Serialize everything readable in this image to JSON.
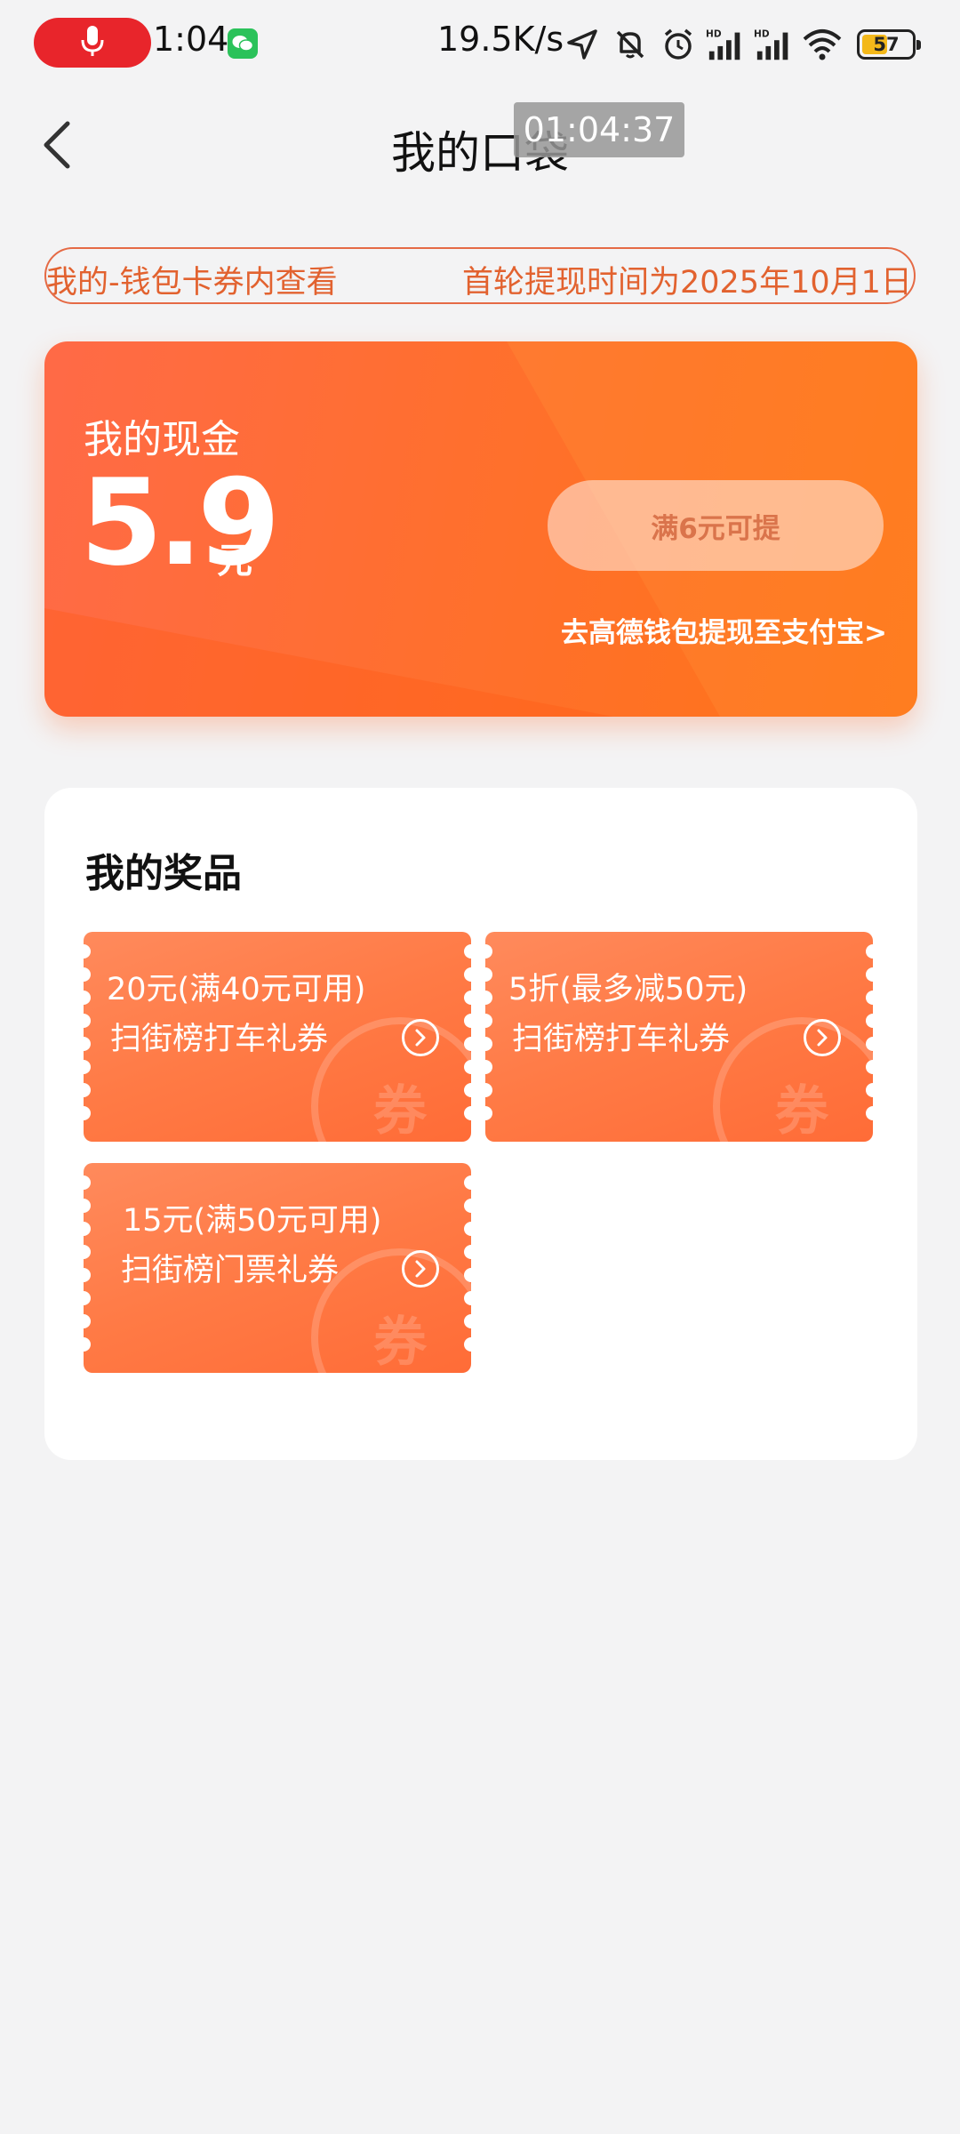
{
  "status_bar": {
    "time": "1:04",
    "network_speed": "19.5K/s",
    "battery_level": "57",
    "icons": [
      "microphone-icon",
      "wechat-icon",
      "location-icon",
      "mute-bell-icon",
      "alarm-icon",
      "hd-signal-icon",
      "hd-signal-icon",
      "wifi-icon",
      "battery-icon"
    ]
  },
  "nav": {
    "title": "我的口袋",
    "timestamp_overlay": "01:04:37"
  },
  "notice": {
    "left_text": "我的-钱包卡券内查看",
    "right_text": "首轮提现时间为2025年10月1日"
  },
  "cash": {
    "label": "我的现金",
    "amount": "5.9",
    "unit": "元",
    "withdraw_button": "满6元可提",
    "wallet_link": "去高德钱包提现至支付宝>"
  },
  "prizes": {
    "title": "我的奖品",
    "watermark": "券",
    "coupons": [
      {
        "amount": "20元(满40元可用)",
        "name": "扫街榜打车礼券"
      },
      {
        "amount": "5折(最多减50元)",
        "name": "扫街榜打车礼券"
      },
      {
        "amount": "15元(满50元可用)",
        "name": "扫街榜门票礼券"
      }
    ]
  },
  "colors": {
    "accent": "#ff6f2f",
    "notice_border": "#e56a45",
    "page_background": "#f3f3f4",
    "recording_pill": "#e8252b"
  }
}
